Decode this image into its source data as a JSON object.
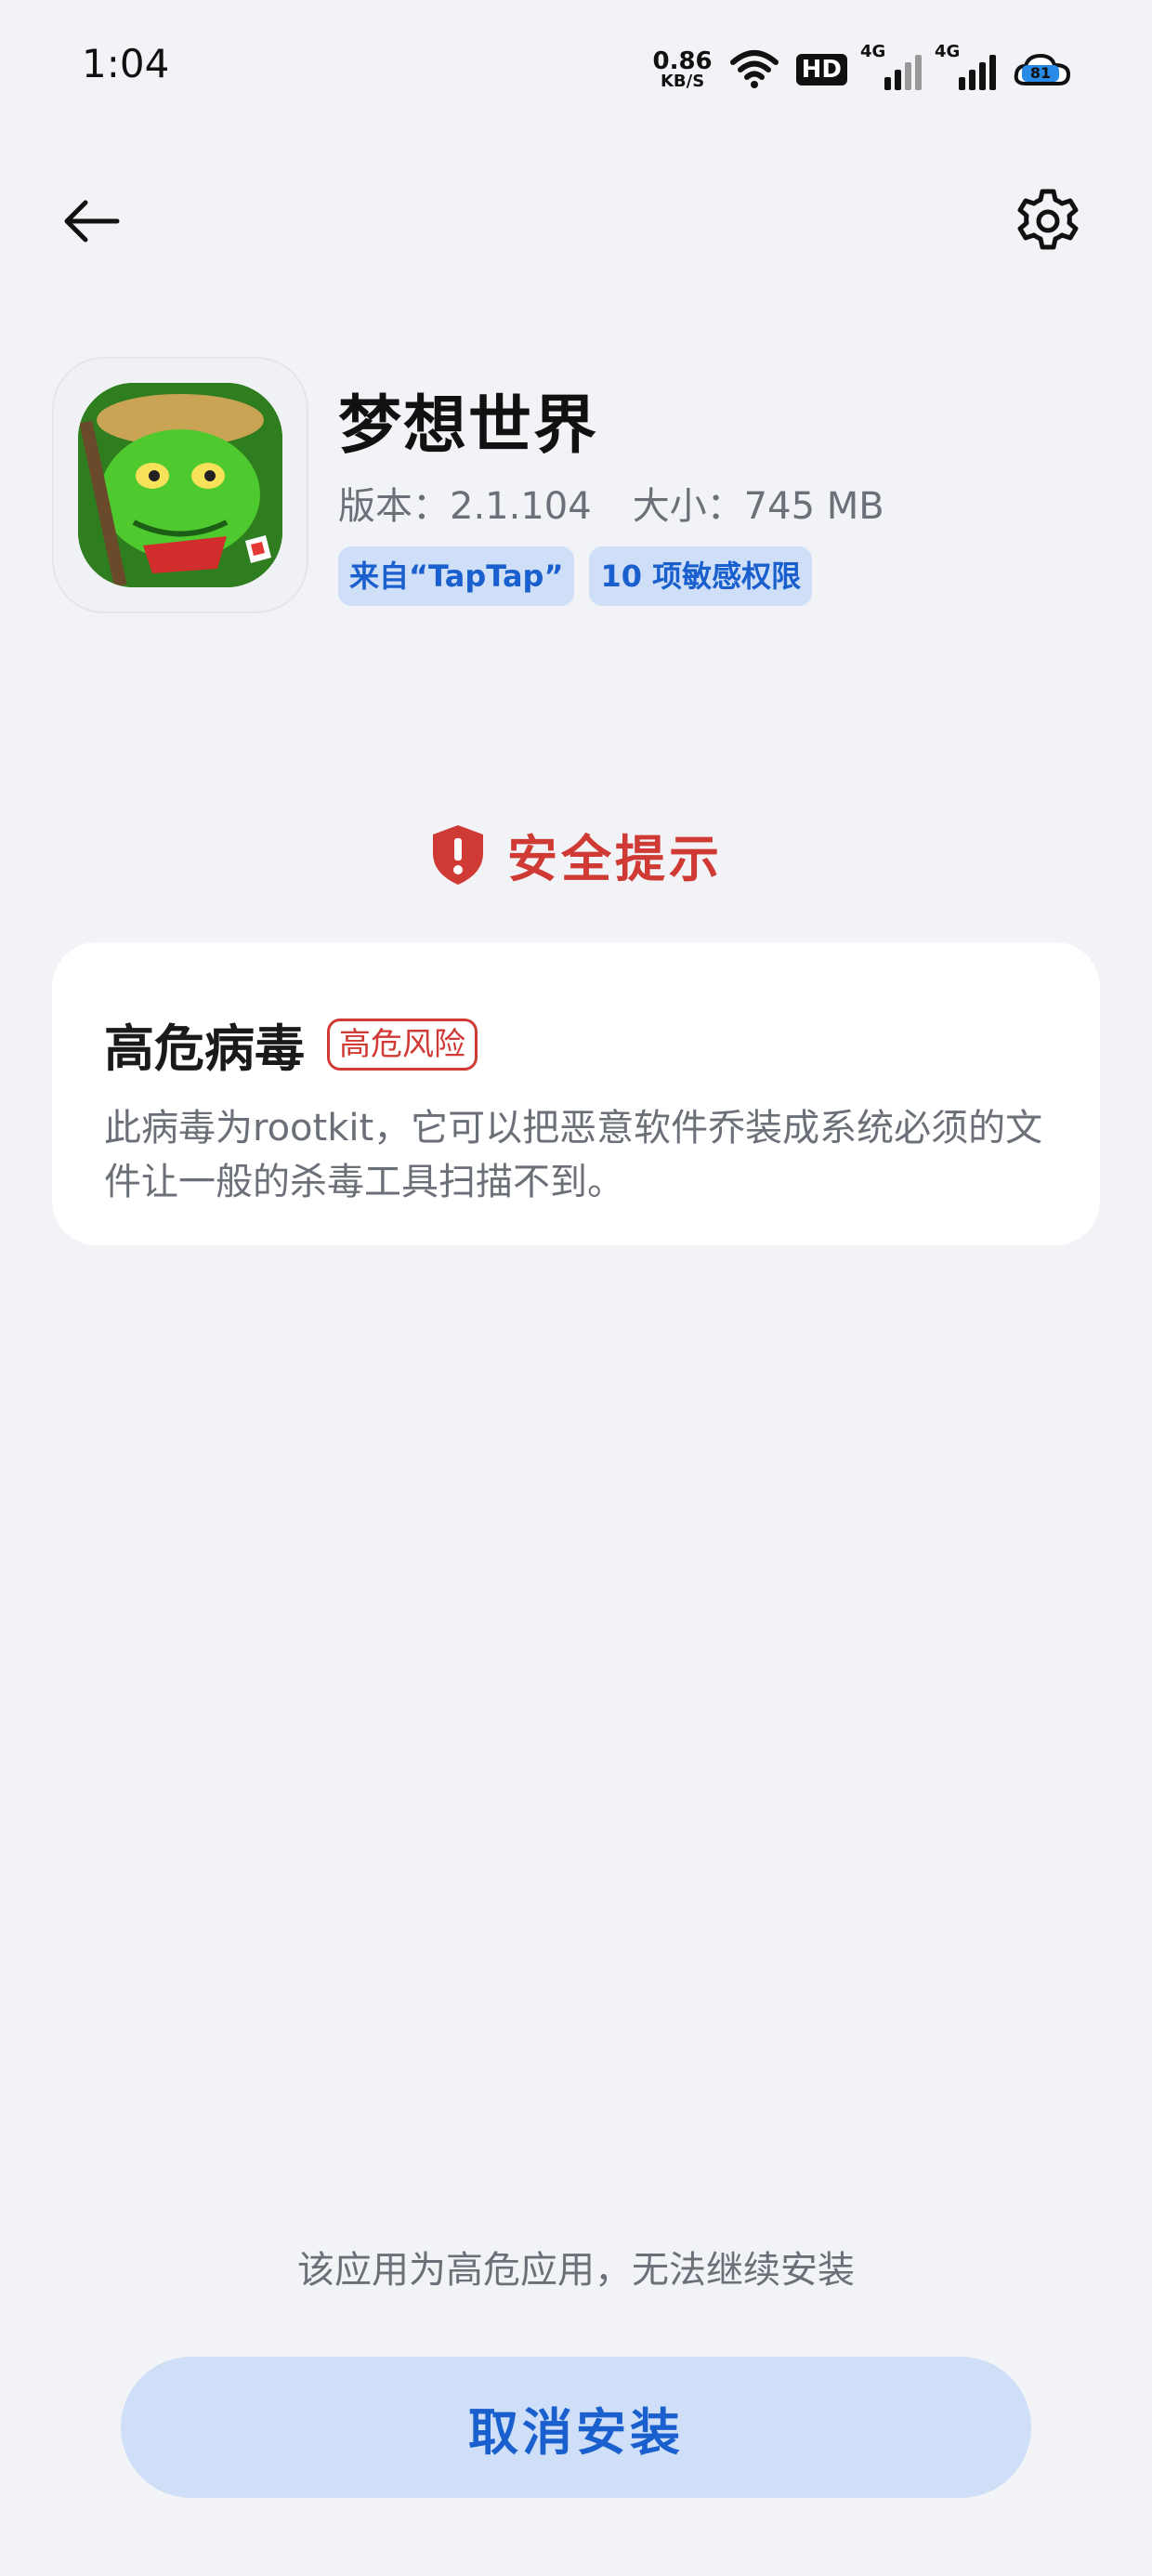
{
  "status_bar": {
    "time": "1:04",
    "net_speed_value": "0.86",
    "net_speed_unit": "KB/S",
    "hd_label": "HD",
    "signal1_label": "4G",
    "signal2_label": "4G",
    "battery_level": "81"
  },
  "toolbar": {
    "back_icon": "arrow-left-icon",
    "settings_icon": "gear-icon"
  },
  "app": {
    "name": "梦想世界",
    "version_text": "版本：2.1.104",
    "size_text": "大小：745 MB",
    "source_chip": "来自“TapTap”",
    "permissions_chip": "10 项敏感权限"
  },
  "security": {
    "title": "安全提示",
    "icon": "shield-alert-icon",
    "accent_color": "#d03a34"
  },
  "threat_card": {
    "title": "高危病毒",
    "risk_badge": "高危风险",
    "description": "此病毒为rootkit，它可以把恶意软件乔装成系统必须的文件让一般的杀毒工具扫描不到。"
  },
  "footer": {
    "note": "该应用为高危应用，无法继续安装",
    "cancel_label": "取消安装",
    "button_color": "#cfdff7",
    "button_text_color": "#1a5fce"
  }
}
